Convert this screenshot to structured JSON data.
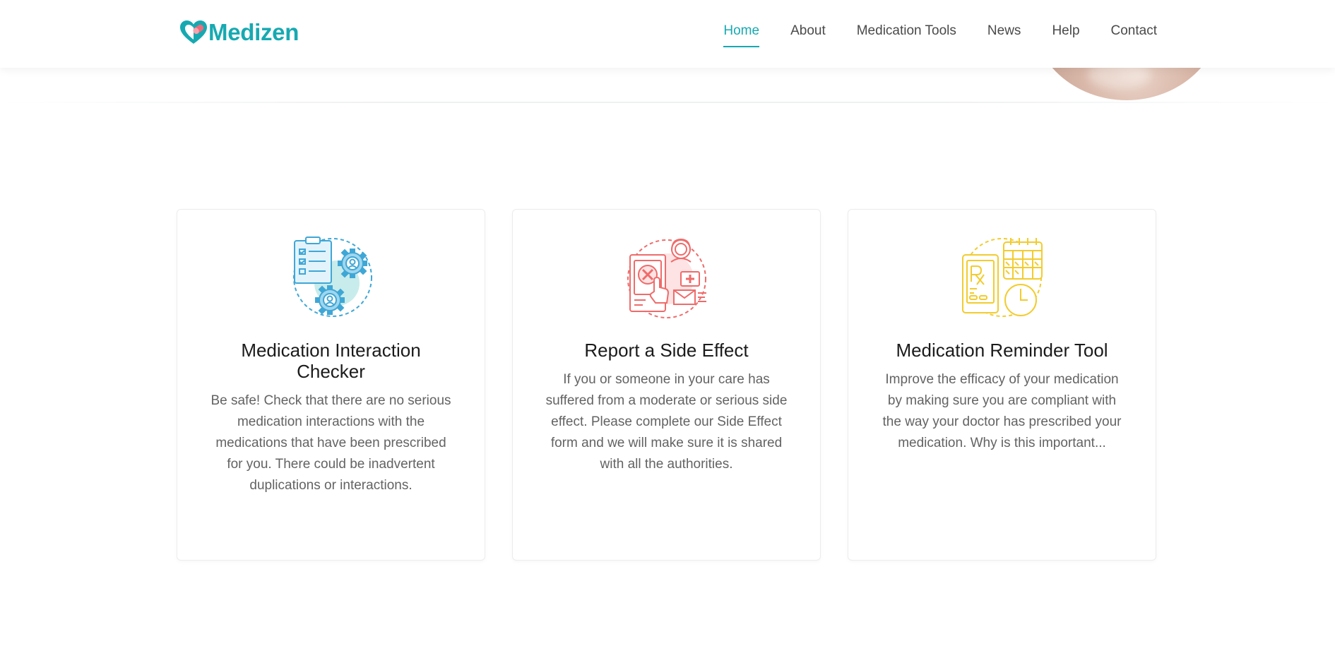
{
  "brand": {
    "name": "Medizen",
    "primary_color": "#17a9b1"
  },
  "nav": {
    "items": [
      {
        "label": "Home",
        "active": true
      },
      {
        "label": "About",
        "active": false
      },
      {
        "label": "Medication Tools",
        "active": false
      },
      {
        "label": "News",
        "active": false
      },
      {
        "label": "Help",
        "active": false
      },
      {
        "label": "Contact",
        "active": false
      }
    ]
  },
  "cards": [
    {
      "icon": "checklist-gears-icon",
      "icon_color": "#3fa7d6",
      "title": "Medication Interaction Checker",
      "description": "Be safe! Check that there are no serious medication interactions with the medications that have been prescribed for you. There could be inadvertent duplications or interactions."
    },
    {
      "icon": "report-side-effect-icon",
      "icon_color": "#ef6b6b",
      "title": "Report a Side Effect",
      "description": "If you or someone in your care has suffered from a moderate or serious side effect. Please complete our Side Effect form and we will make sure it is shared with all the authorities."
    },
    {
      "icon": "reminder-calendar-clock-icon",
      "icon_color": "#f2cc2e",
      "title": "Medication Reminder Tool",
      "description": "Improve the efficacy of your medication by making sure you are compliant with the way your doctor has prescribed your medication. Why is this important..."
    }
  ]
}
